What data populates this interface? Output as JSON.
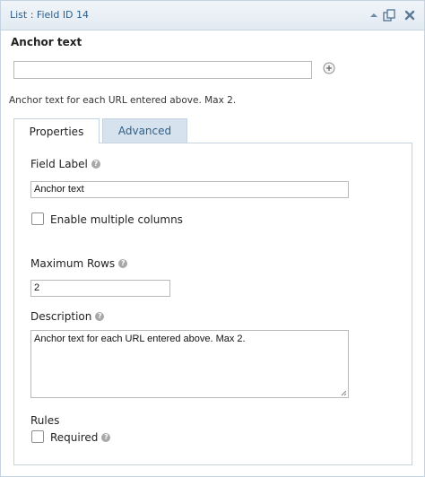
{
  "header": {
    "title": "List : Field ID 14",
    "icons": [
      "collapse-arrow-icon",
      "duplicate-icon",
      "delete-icon"
    ]
  },
  "field_preview": {
    "label": "Anchor text",
    "input_value": "",
    "description": "Anchor text for each URL entered above. Max 2."
  },
  "tabs": [
    {
      "label": "Properties",
      "active": true
    },
    {
      "label": "Advanced",
      "active": false
    }
  ],
  "properties": {
    "field_label": {
      "label": "Field Label",
      "value": "Anchor text"
    },
    "multiple_columns": {
      "label": "Enable multiple columns",
      "checked": false
    },
    "maximum_rows": {
      "label": "Maximum Rows",
      "value": "2"
    },
    "description": {
      "label": "Description",
      "value": "Anchor text for each URL entered above. Max 2."
    },
    "rules": {
      "label": "Rules"
    },
    "required": {
      "label": "Required",
      "checked": false
    }
  },
  "help_glyph": "?",
  "colors": {
    "accent": "#2e5f8a",
    "border": "#c5d3e0",
    "inactive_tab": "#d6e3ee"
  }
}
